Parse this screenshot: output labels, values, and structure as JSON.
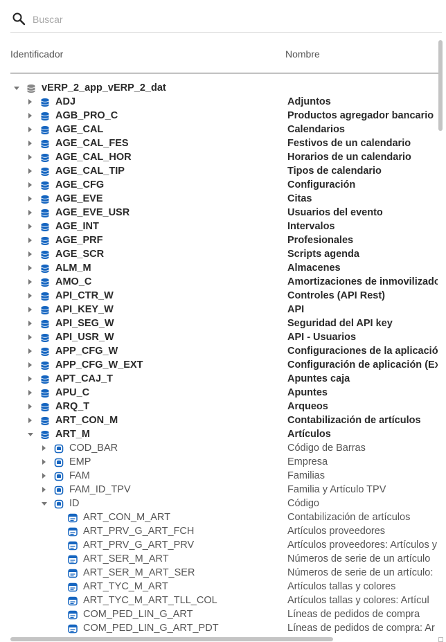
{
  "search": {
    "placeholder": "Buscar",
    "value": ""
  },
  "columns": {
    "id": "Identificador",
    "name": "Nombre"
  },
  "colors": {
    "db_icon": "#1565c0",
    "root_icon": "#888888",
    "text_bold": "#2a2a2a",
    "text_normal": "#555555"
  },
  "tree": [
    {
      "id": "vERP_2_app_vERP_2_dat",
      "name": "",
      "level": 0,
      "expand": "down",
      "icon": "root-db-icon",
      "bold": true
    },
    {
      "id": "ADJ",
      "name": "Adjuntos",
      "level": 1,
      "expand": "right",
      "icon": "database-icon",
      "bold": true
    },
    {
      "id": "AGB_PRO_C",
      "name": "Productos agregador bancario",
      "level": 1,
      "expand": "right",
      "icon": "database-icon",
      "bold": true
    },
    {
      "id": "AGE_CAL",
      "name": "Calendarios",
      "level": 1,
      "expand": "right",
      "icon": "database-icon",
      "bold": true
    },
    {
      "id": "AGE_CAL_FES",
      "name": "Festivos de un calendario",
      "level": 1,
      "expand": "right",
      "icon": "database-icon",
      "bold": true
    },
    {
      "id": "AGE_CAL_HOR",
      "name": "Horarios de un calendario",
      "level": 1,
      "expand": "right",
      "icon": "database-icon",
      "bold": true
    },
    {
      "id": "AGE_CAL_TIP",
      "name": "Tipos de calendario",
      "level": 1,
      "expand": "right",
      "icon": "database-icon",
      "bold": true
    },
    {
      "id": "AGE_CFG",
      "name": "Configuración",
      "level": 1,
      "expand": "right",
      "icon": "database-icon",
      "bold": true
    },
    {
      "id": "AGE_EVE",
      "name": "Citas",
      "level": 1,
      "expand": "right",
      "icon": "database-icon",
      "bold": true
    },
    {
      "id": "AGE_EVE_USR",
      "name": "Usuarios del evento",
      "level": 1,
      "expand": "right",
      "icon": "database-icon",
      "bold": true
    },
    {
      "id": "AGE_INT",
      "name": "Intervalos",
      "level": 1,
      "expand": "right",
      "icon": "database-icon",
      "bold": true
    },
    {
      "id": "AGE_PRF",
      "name": "Profesionales",
      "level": 1,
      "expand": "right",
      "icon": "database-icon",
      "bold": true
    },
    {
      "id": "AGE_SCR",
      "name": "Scripts agenda",
      "level": 1,
      "expand": "right",
      "icon": "database-icon",
      "bold": true
    },
    {
      "id": "ALM_M",
      "name": "Almacenes",
      "level": 1,
      "expand": "right",
      "icon": "database-icon",
      "bold": true
    },
    {
      "id": "AMO_C",
      "name": "Amortizaciones de inmovilizado",
      "level": 1,
      "expand": "right",
      "icon": "database-icon",
      "bold": true
    },
    {
      "id": "API_CTR_W",
      "name": "Controles (API Rest)",
      "level": 1,
      "expand": "right",
      "icon": "database-icon",
      "bold": true
    },
    {
      "id": "API_KEY_W",
      "name": "API",
      "level": 1,
      "expand": "right",
      "icon": "database-icon",
      "bold": true
    },
    {
      "id": "API_SEG_W",
      "name": "Seguridad del API key",
      "level": 1,
      "expand": "right",
      "icon": "database-icon",
      "bold": true
    },
    {
      "id": "API_USR_W",
      "name": "API - Usuarios",
      "level": 1,
      "expand": "right",
      "icon": "database-icon",
      "bold": true
    },
    {
      "id": "APP_CFG_W",
      "name": "Configuraciones de la aplicación",
      "level": 1,
      "expand": "right",
      "icon": "database-icon",
      "bold": true
    },
    {
      "id": "APP_CFG_W_EXT",
      "name": "Configuración de aplicación (Ex",
      "level": 1,
      "expand": "right",
      "icon": "database-icon",
      "bold": true
    },
    {
      "id": "APT_CAJ_T",
      "name": "Apuntes caja",
      "level": 1,
      "expand": "right",
      "icon": "database-icon",
      "bold": true
    },
    {
      "id": "APU_C",
      "name": "Apuntes",
      "level": 1,
      "expand": "right",
      "icon": "database-icon",
      "bold": true
    },
    {
      "id": "ARQ_T",
      "name": "Arqueos",
      "level": 1,
      "expand": "right",
      "icon": "database-icon",
      "bold": true
    },
    {
      "id": "ART_CON_M",
      "name": "Contabilización de artículos",
      "level": 1,
      "expand": "right",
      "icon": "database-icon",
      "bold": true
    },
    {
      "id": "ART_M",
      "name": "Artículos",
      "level": 1,
      "expand": "down",
      "icon": "database-icon",
      "bold": true
    },
    {
      "id": "COD_BAR",
      "name": "Código de Barras",
      "level": 2,
      "expand": "right",
      "icon": "field-icon",
      "bold": false
    },
    {
      "id": "EMP",
      "name": "Empresa",
      "level": 2,
      "expand": "right",
      "icon": "field-icon",
      "bold": false
    },
    {
      "id": "FAM",
      "name": "Familias",
      "level": 2,
      "expand": "right",
      "icon": "field-icon",
      "bold": false
    },
    {
      "id": "FAM_ID_TPV",
      "name": "Familia y Artículo TPV",
      "level": 2,
      "expand": "right",
      "icon": "field-icon",
      "bold": false
    },
    {
      "id": "ID",
      "name": "Código",
      "level": 2,
      "expand": "down",
      "icon": "field-icon",
      "bold": false
    },
    {
      "id": "ART_CON_M_ART",
      "name": "Contabilización de artículos",
      "level": 3,
      "expand": "none",
      "icon": "relation-icon",
      "bold": false
    },
    {
      "id": "ART_PRV_G_ART_FCH",
      "name": "Artículos proveedores",
      "level": 3,
      "expand": "none",
      "icon": "relation-icon",
      "bold": false
    },
    {
      "id": "ART_PRV_G_ART_PRV",
      "name": "Artículos proveedores: Artículos y",
      "level": 3,
      "expand": "none",
      "icon": "relation-icon",
      "bold": false
    },
    {
      "id": "ART_SER_M_ART",
      "name": "Números de serie de un artículo",
      "level": 3,
      "expand": "none",
      "icon": "relation-icon",
      "bold": false
    },
    {
      "id": "ART_SER_M_ART_SER",
      "name": "Números de serie de un artículo:",
      "level": 3,
      "expand": "none",
      "icon": "relation-icon",
      "bold": false
    },
    {
      "id": "ART_TYC_M_ART",
      "name": "Artículos tallas y colores",
      "level": 3,
      "expand": "none",
      "icon": "relation-icon",
      "bold": false
    },
    {
      "id": "ART_TYC_M_ART_TLL_COL",
      "name": "Artículos tallas y colores: Artícul",
      "level": 3,
      "expand": "none",
      "icon": "relation-icon",
      "bold": false
    },
    {
      "id": "COM_PED_LIN_G_ART",
      "name": "Líneas de pedidos de compra",
      "level": 3,
      "expand": "none",
      "icon": "relation-icon",
      "bold": false
    },
    {
      "id": "COM_PED_LIN_G_ART_PDT",
      "name": "Líneas de pedidos de compra: Ar",
      "level": 3,
      "expand": "none",
      "icon": "relation-icon",
      "bold": false
    }
  ]
}
